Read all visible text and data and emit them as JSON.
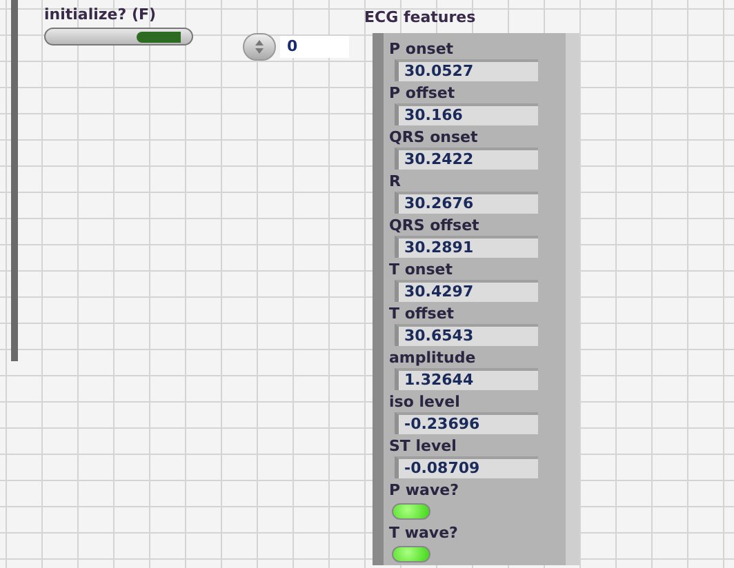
{
  "switch": {
    "label": "initialize? (F)",
    "on": false
  },
  "numeric_control": {
    "value": "0"
  },
  "cluster": {
    "title": "ECG features",
    "items": [
      {
        "kind": "numeric",
        "label": "P onset",
        "value": "30.0527"
      },
      {
        "kind": "numeric",
        "label": "P offset",
        "value": "30.166"
      },
      {
        "kind": "numeric",
        "label": "QRS onset",
        "value": "30.2422"
      },
      {
        "kind": "numeric",
        "label": "R",
        "value": "30.2676"
      },
      {
        "kind": "numeric",
        "label": "QRS offset",
        "value": "30.2891"
      },
      {
        "kind": "numeric",
        "label": "T onset",
        "value": "30.4297"
      },
      {
        "kind": "numeric",
        "label": "T offset",
        "value": "30.6543"
      },
      {
        "kind": "numeric",
        "label": "amplitude",
        "value": "1.32644"
      },
      {
        "kind": "numeric",
        "label": "iso level",
        "value": "-0.23696"
      },
      {
        "kind": "numeric",
        "label": "ST level",
        "value": "-0.08709"
      },
      {
        "kind": "led",
        "label": "P wave?",
        "on": true
      },
      {
        "kind": "led",
        "label": "T wave?",
        "on": true
      }
    ]
  }
}
